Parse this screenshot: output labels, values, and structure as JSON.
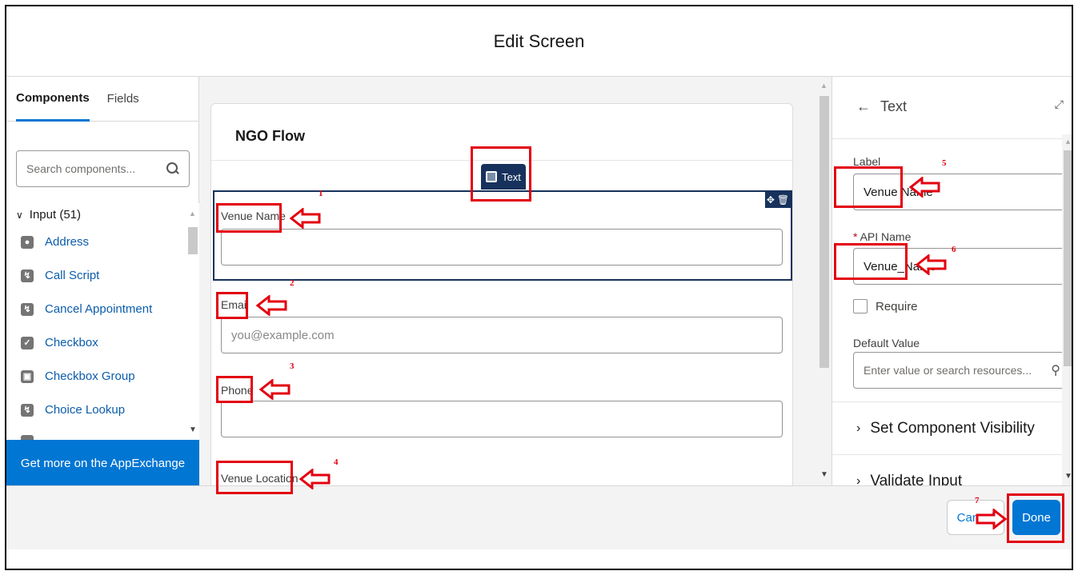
{
  "header": {
    "title": "Edit Screen"
  },
  "left_panel": {
    "tabs": [
      "Components",
      "Fields"
    ],
    "search_placeholder": "Search components...",
    "group_label": "Input (51)",
    "items": [
      {
        "label": "Address",
        "icon": "location-icon"
      },
      {
        "label": "Call Script",
        "icon": "lightning-icon"
      },
      {
        "label": "Cancel Appointment",
        "icon": "lightning-icon"
      },
      {
        "label": "Checkbox",
        "icon": "checkbox-icon"
      },
      {
        "label": "Checkbox Group",
        "icon": "checkbox-group-icon"
      },
      {
        "label": "Choice Lookup",
        "icon": "lightning-icon"
      }
    ],
    "appexchange_label": "Get more on the AppExchange"
  },
  "canvas": {
    "flow_title": "NGO Flow",
    "chip_label": "Text",
    "fields": [
      {
        "label": "Venue Name",
        "placeholder": ""
      },
      {
        "label": "Email",
        "placeholder": "you@example.com"
      },
      {
        "label": "Phone",
        "placeholder": ""
      },
      {
        "label": "Venue Location",
        "placeholder": ""
      }
    ]
  },
  "properties": {
    "header": "Text",
    "label_caption": "Label",
    "label_value": "Venue Name",
    "api_caption": "API Name",
    "api_required_mark": "*",
    "api_value": "Venue_Name",
    "require_label": "Require",
    "default_caption": "Default Value",
    "default_placeholder": "Enter value or search resources...",
    "sections": [
      "Set Component Visibility",
      "Validate Input"
    ]
  },
  "footer": {
    "cancel_label": "Cancel",
    "done_label": "Done"
  },
  "annotations": {
    "numbers": [
      "1",
      "2",
      "3",
      "4",
      "5",
      "6",
      "7"
    ],
    "color": "#e3000f"
  },
  "colors": {
    "brand": "#0176d3",
    "selection": "#16325c"
  }
}
